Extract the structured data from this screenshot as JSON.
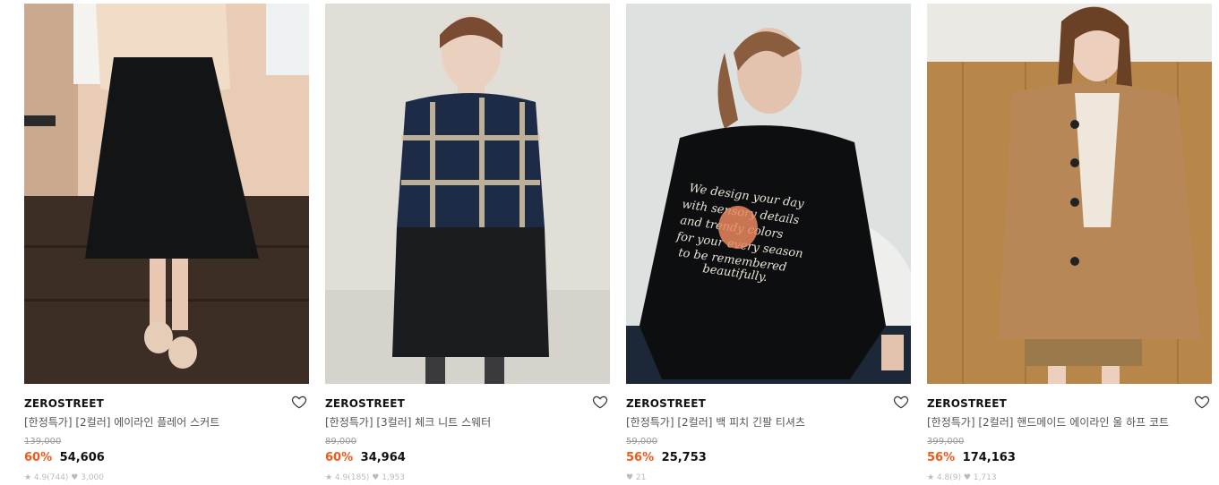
{
  "products": [
    {
      "brand": "ZEROSTREET",
      "title": "[한정특가] [2컬러] 에이라인 플레어 스커트",
      "original_price": "139,000",
      "discount": "60%",
      "price": "54,606",
      "stats": "★ 4.9(744)  ♥ 3,000",
      "image_icon": "black-flare-skirt-image",
      "colors": {
        "bg": "#e9cdb8",
        "garment": "#141617",
        "top": "#f1ddc9",
        "floor": "#4a3a30"
      }
    },
    {
      "brand": "ZEROSTREET",
      "title": "[한정특가] [3컬러] 체크 니트 스웨터",
      "original_price": "89,000",
      "discount": "60%",
      "price": "34,964",
      "stats": "★ 4.9(185)  ♥ 1,953",
      "image_icon": "check-knit-sweater-image",
      "colors": {
        "bg": "#e2e0db",
        "garment": "#1d2a45",
        "top": "#1d2a45",
        "floor": "#d9d6d0"
      }
    },
    {
      "brand": "ZEROSTREET",
      "title": "[한정특가] [2컬러] 백 피치 긴팔 티셔츠",
      "original_price": "59,000",
      "discount": "56%",
      "price": "25,753",
      "stats": "♥ 21",
      "image_icon": "peach-print-long-sleeve-image",
      "colors": {
        "bg": "#dfe3e2",
        "garment": "#0e0f11",
        "top": "#0e0f11",
        "floor": "#1d2a3a"
      }
    },
    {
      "brand": "ZEROSTREET",
      "title": "[한정특가] [2컬러] 핸드메이드 에이라인 울 하프 코트",
      "original_price": "399,000",
      "discount": "56%",
      "price": "174,163",
      "stats": "★ 4.8(9)  ♥ 1,713",
      "image_icon": "camel-wool-coat-image",
      "colors": {
        "bg": "#b98a4a",
        "garment": "#b88758",
        "top": "#f0e9e0",
        "floor": "#8a6a3e"
      }
    }
  ],
  "icons": {
    "wishlist": "heart-outline-icon"
  }
}
